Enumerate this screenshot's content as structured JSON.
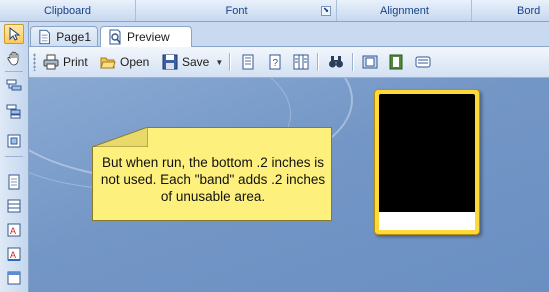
{
  "ribbon": {
    "groups": [
      "Clipboard",
      "Font",
      "Alignment",
      "Bord"
    ]
  },
  "tabs": [
    {
      "label": "Page1",
      "icon": "document-icon"
    },
    {
      "label": "Preview",
      "icon": "print-preview-icon"
    }
  ],
  "toolbar": {
    "print_label": "Print",
    "open_label": "Open",
    "save_label": "Save"
  },
  "note": {
    "text": "But when run, the bottom .2 inches is not used. Each \"band\" adds .2 inches of unusable area."
  },
  "colors": {
    "canvas": "#7396c6",
    "note": "#fdf07c",
    "thumb_border": "#ffd83a"
  }
}
